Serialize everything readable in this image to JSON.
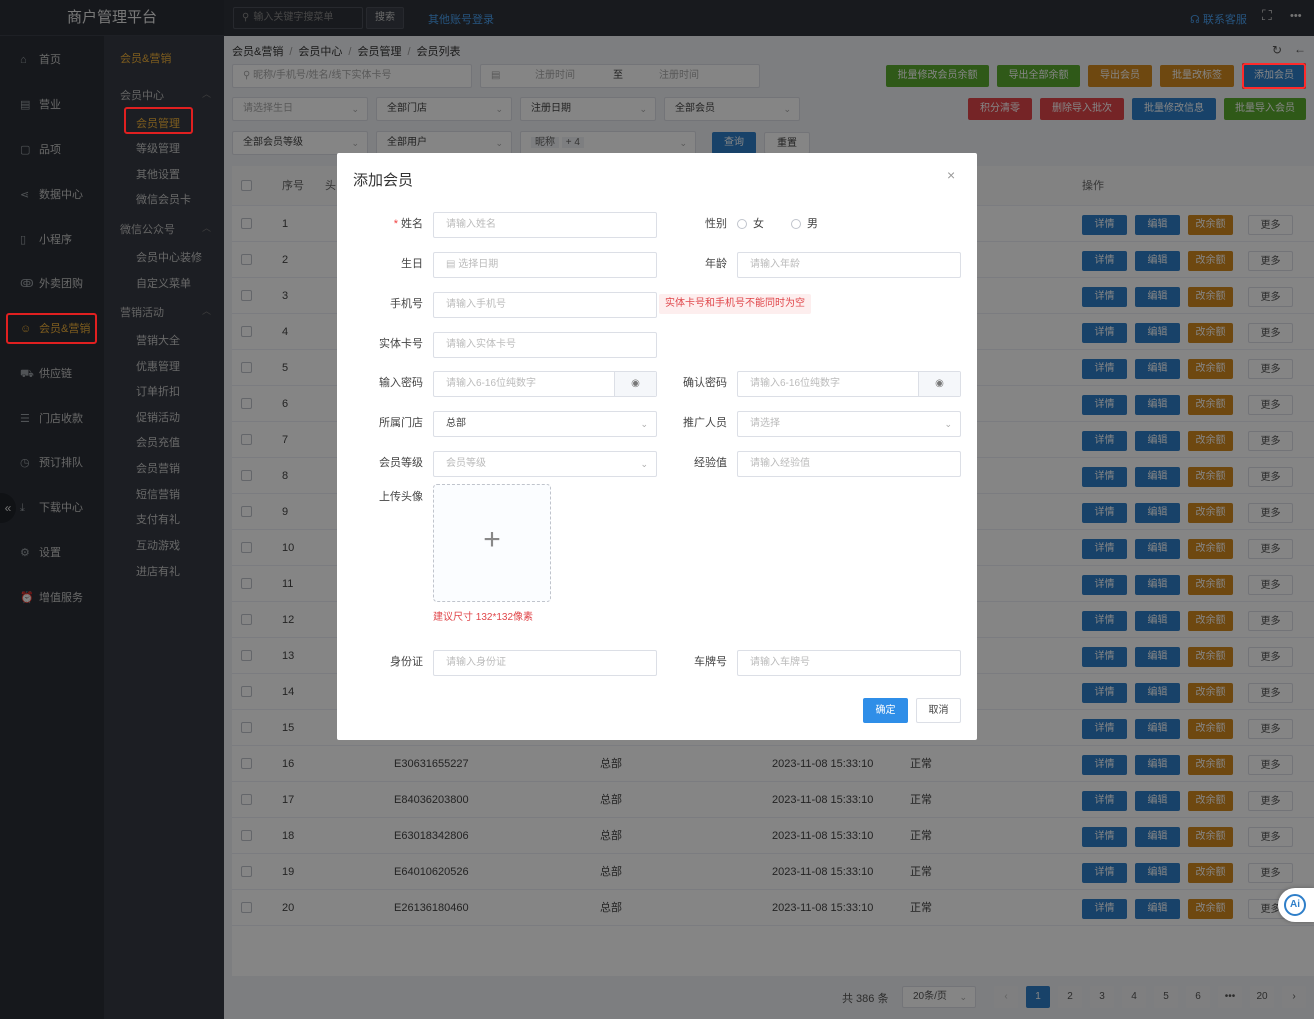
{
  "app_title": "商户管理平台",
  "topbar": {
    "search_placeholder": "输入关键字搜菜单",
    "search_btn": "搜索",
    "other_login": "其他账号登录",
    "contact": "联系客服",
    "more": "•••"
  },
  "sidebar_main": [
    {
      "label": "首页",
      "icon": "home-icon",
      "glyph": "⌂"
    },
    {
      "label": "营业",
      "icon": "calendar-icon",
      "glyph": "▤"
    },
    {
      "label": "品项",
      "icon": "bag-icon",
      "glyph": "▢"
    },
    {
      "label": "数据中心",
      "icon": "share-icon",
      "glyph": "⋖"
    },
    {
      "label": "小程序",
      "icon": "phone-icon",
      "glyph": "▯"
    },
    {
      "label": "外卖团购",
      "icon": "bike-icon",
      "glyph": "ↂ"
    },
    {
      "label": "会员&营销",
      "icon": "user-icon",
      "glyph": "☺"
    },
    {
      "label": "供应链",
      "icon": "truck-icon",
      "glyph": "⛟"
    },
    {
      "label": "门店收款",
      "icon": "database-icon",
      "glyph": "☰"
    },
    {
      "label": "预订排队",
      "icon": "clock-icon",
      "glyph": "◷"
    },
    {
      "label": "下载中心",
      "icon": "download-icon",
      "glyph": "⤓"
    },
    {
      "label": "设置",
      "icon": "gear-icon",
      "glyph": "⚙"
    },
    {
      "label": "增值服务",
      "icon": "alarm-icon",
      "glyph": "⏰"
    }
  ],
  "sidebar_sub": {
    "title": "会员&营销",
    "groups": [
      {
        "label": "会员中心",
        "items": [
          "会员管理",
          "等级管理",
          "其他设置",
          "微信会员卡"
        ]
      },
      {
        "label": "微信公众号",
        "items": [
          "会员中心装修",
          "自定义菜单"
        ]
      },
      {
        "label": "营销活动",
        "items": [
          "营销大全",
          "优惠管理",
          "订单折扣",
          "促销活动",
          "会员充值",
          "会员营销",
          "短信营销",
          "支付有礼",
          "互动游戏",
          "进店有礼"
        ]
      }
    ]
  },
  "breadcrumb": [
    "会员&营销",
    "会员中心",
    "会员管理",
    "会员列表"
  ],
  "filters": {
    "keyword_placeholder": "昵称/手机号/姓名/线下实体卡号",
    "date_start": "注册时间",
    "date_sep": "至",
    "date_end": "注册时间",
    "birthday": "请选择生日",
    "store": "全部门店",
    "reg_date": "注册日期",
    "member": "全部会员",
    "level": "全部会员等级",
    "user": "全部用户",
    "nickname": "昵称",
    "nickname_tag": "+ 4",
    "query": "查询",
    "reset": "重置"
  },
  "actions_row1": [
    "批量修改会员余额",
    "导出全部余额",
    "导出会员",
    "批量改标签",
    "添加会员"
  ],
  "actions_row2": [
    "积分清零",
    "删除导入批次",
    "批量修改信息",
    "批量导入会员"
  ],
  "colors": {
    "green": "#5aab2e",
    "orange": "#d48a1f",
    "blue": "#2f7fc9",
    "red": "#e0464a",
    "accent": "#f0b03a"
  },
  "table": {
    "headers": {
      "seq": "序号",
      "head": "头",
      "ops": "操作"
    },
    "ops": [
      "详情",
      "编辑",
      "改余额",
      "更多"
    ],
    "rows": [
      {
        "seq": "1"
      },
      {
        "seq": "2"
      },
      {
        "seq": "3"
      },
      {
        "seq": "4"
      },
      {
        "seq": "5"
      },
      {
        "seq": "6"
      },
      {
        "seq": "7"
      },
      {
        "seq": "8"
      },
      {
        "seq": "9"
      },
      {
        "seq": "10"
      },
      {
        "seq": "11"
      },
      {
        "seq": "12"
      },
      {
        "seq": "13"
      },
      {
        "seq": "14"
      },
      {
        "seq": "15"
      },
      {
        "seq": "16",
        "card": "E30631655227",
        "store": "总部",
        "time": "2023-11-08 15:33:10",
        "status": "正常"
      },
      {
        "seq": "17",
        "card": "E84036203800",
        "store": "总部",
        "time": "2023-11-08 15:33:10",
        "status": "正常"
      },
      {
        "seq": "18",
        "card": "E63018342806",
        "store": "总部",
        "time": "2023-11-08 15:33:10",
        "status": "正常"
      },
      {
        "seq": "19",
        "card": "E64010620526",
        "store": "总部",
        "time": "2023-11-08 15:33:10",
        "status": "正常"
      },
      {
        "seq": "20",
        "card": "E26136180460",
        "store": "总部",
        "time": "2023-11-08 15:33:10",
        "status": "正常"
      }
    ]
  },
  "pagination": {
    "total": "共 386 条",
    "size": "20条/页",
    "pages": [
      "1",
      "2",
      "3",
      "4",
      "5",
      "6",
      "•••",
      "20"
    ],
    "prev": "‹",
    "next": "›"
  },
  "modal": {
    "title": "添加会员",
    "name_label": "姓名",
    "name_ph": "请输入姓名",
    "gender_label": "性别",
    "female": "女",
    "male": "男",
    "birthday_label": "生日",
    "birthday_ph": "选择日期",
    "age_label": "年龄",
    "age_ph": "请输入年龄",
    "phone_label": "手机号",
    "phone_ph": "请输入手机号",
    "phone_error": "实体卡号和手机号不能同时为空",
    "card_label": "实体卡号",
    "card_ph": "请输入实体卡号",
    "pwd_label": "输入密码",
    "pwd_ph": "请输入6-16位纯数字",
    "pwd2_label": "确认密码",
    "pwd2_ph": "请输入6-16位纯数字",
    "store_label": "所属门店",
    "store_val": "总部",
    "promoter_label": "推广人员",
    "promoter_ph": "请选择",
    "level_label": "会员等级",
    "level_ph": "会员等级",
    "exp_label": "经验值",
    "exp_ph": "请输入经验值",
    "avatar_label": "上传头像",
    "avatar_hint": "建议尺寸 132*132像素",
    "id_label": "身份证",
    "id_ph": "请输入身份证",
    "plate_label": "车牌号",
    "plate_ph": "请输入车牌号",
    "confirm": "确定",
    "cancel": "取消"
  }
}
